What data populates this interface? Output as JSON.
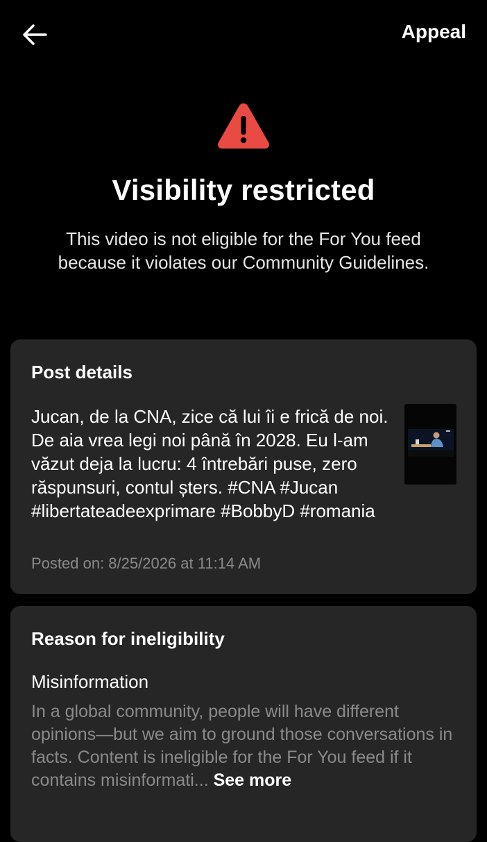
{
  "header": {
    "back_icon": "arrow-left-icon",
    "appeal_label": "Appeal"
  },
  "status": {
    "icon": "warning-triangle-icon",
    "icon_color": "#e94a43",
    "title": "Visibility restricted",
    "description": "This video is not eligible for the For You feed because it violates our Community Guidelines."
  },
  "post_details": {
    "heading": "Post details",
    "caption": "Jucan, de la CNA, zice că lui îi e frică de noi. De aia vrea legi noi până în 2028. Eu l-am văzut deja la lucru: 4 întrebări puse, zero răspunsuri, contul șters. #CNA #Jucan #libertateadeexprimare #BobbyD #romania",
    "posted_on": "Posted on: 8/25/2026 at 11:14 AM"
  },
  "reason": {
    "heading": "Reason for ineligibility",
    "title": "Misinformation",
    "body": "In a global community, people will have different opinions—but we aim to ground those conversations in facts. Content is ineligible for the For You feed if it contains misinformati...",
    "see_more_label": "See more"
  }
}
